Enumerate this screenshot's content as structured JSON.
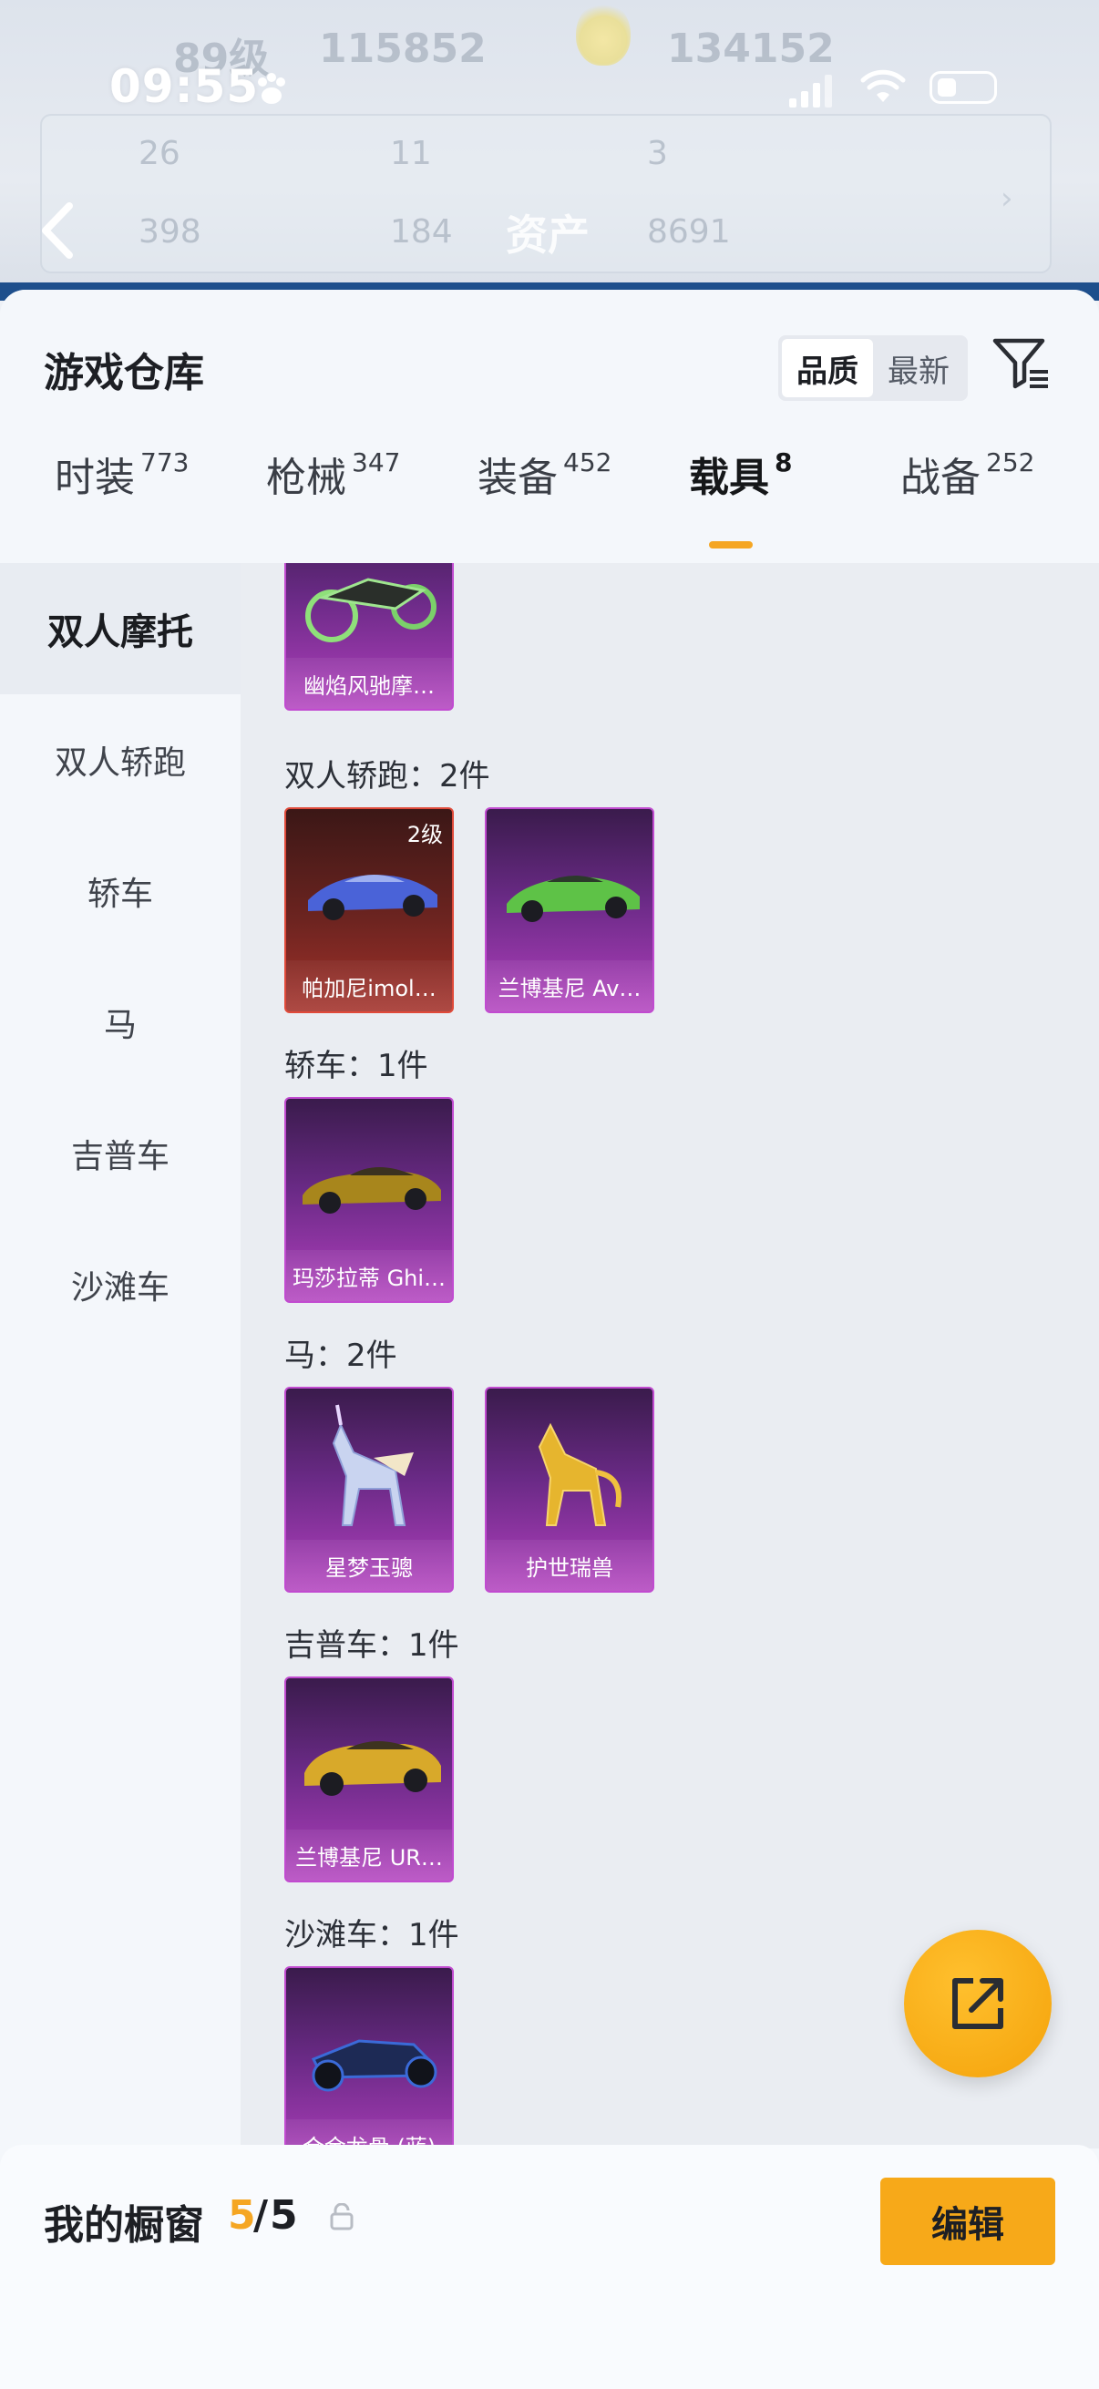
{
  "status_bar": {
    "time": "09:55"
  },
  "background": {
    "level": "89级",
    "score": "115852",
    "score2": "134152",
    "stats": [
      "26",
      "11",
      "3",
      "398",
      "184",
      "8691"
    ],
    "title": "资产"
  },
  "sheet": {
    "title": "游戏仓库",
    "sort": {
      "options": [
        "品质",
        "最新"
      ],
      "selected": "品质"
    }
  },
  "tabs": [
    {
      "label": "时装",
      "count": "773"
    },
    {
      "label": "枪械",
      "count": "347"
    },
    {
      "label": "装备",
      "count": "452"
    },
    {
      "label": "载具",
      "count": "8",
      "active": true
    },
    {
      "label": "战备",
      "count": "252"
    }
  ],
  "sidebar": {
    "items": [
      {
        "label": "双人摩托",
        "active": true
      },
      {
        "label": "双人轿跑"
      },
      {
        "label": "轿车"
      },
      {
        "label": "马"
      },
      {
        "label": "吉普车"
      },
      {
        "label": "沙滩车"
      }
    ]
  },
  "sections": {
    "moto": {
      "items": [
        {
          "name": "幽焰风驰摩…"
        }
      ]
    },
    "coupe": {
      "label": "双人轿跑：2件",
      "items": [
        {
          "name": "帕加尼imol…",
          "level": "2级"
        },
        {
          "name": "兰博基尼 Av…"
        }
      ]
    },
    "sedan": {
      "label": "轿车：1件",
      "items": [
        {
          "name": "玛莎拉蒂 Ghi…"
        }
      ]
    },
    "horse": {
      "label": "马：2件",
      "items": [
        {
          "name": "星梦玉骢"
        },
        {
          "name": "护世瑞兽"
        }
      ]
    },
    "jeep": {
      "label": "吉普车：1件",
      "items": [
        {
          "name": "兰博基尼 UR…"
        }
      ]
    },
    "beach": {
      "label": "沙滩车：1件",
      "items": [
        {
          "name": "合金龙骨 (蓝)"
        }
      ]
    }
  },
  "bottom": {
    "label": "我的橱窗",
    "current": "5",
    "separator": "/",
    "total": "5",
    "edit_label": "编辑"
  },
  "colors": {
    "accent": "#f5a623",
    "purple_card": "#b13fbd",
    "red_card": "#a3312a"
  }
}
